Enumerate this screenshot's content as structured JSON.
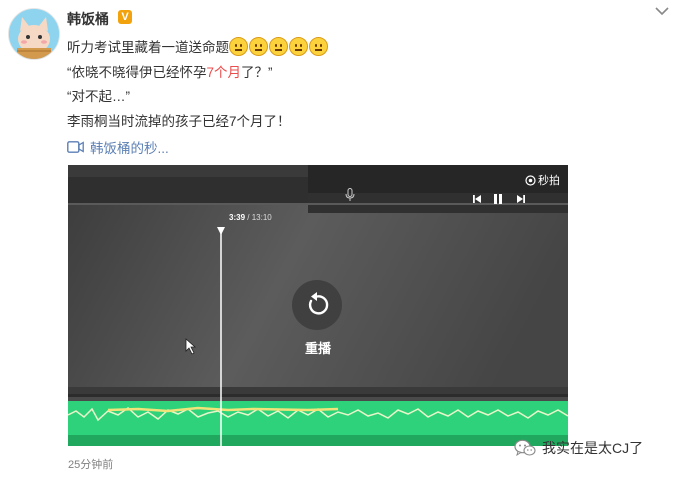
{
  "author": {
    "name": "韩饭桶",
    "verified_badge": "V"
  },
  "post": {
    "line1": "听力考试里藏着一道送命题",
    "line2_before": "“依晓不晓得伊已经怀孕",
    "line2_highlight": "7个月",
    "line2_after": "了？”",
    "line3": "“对不起…”",
    "line4": "李雨桐当时流掉的孩子已经7个月了！"
  },
  "emojis": [
    "smile-emoji",
    "smile-emoji",
    "smile-emoji",
    "smile-emoji",
    "smile-emoji"
  ],
  "video_link": "韩饭桶的秒...",
  "video": {
    "watermark": "秒拍",
    "time_current": "3:39",
    "time_sep": "/",
    "time_total": "13:10",
    "replay_label": "重播"
  },
  "timestamp": "25分钟前",
  "footer_watermark": "我实在是太CJ了",
  "colors": {
    "highlight": "#eb4c4c",
    "link": "#5b7fb4",
    "waveform": "#2ed27a",
    "badge": "#f2a20c"
  }
}
